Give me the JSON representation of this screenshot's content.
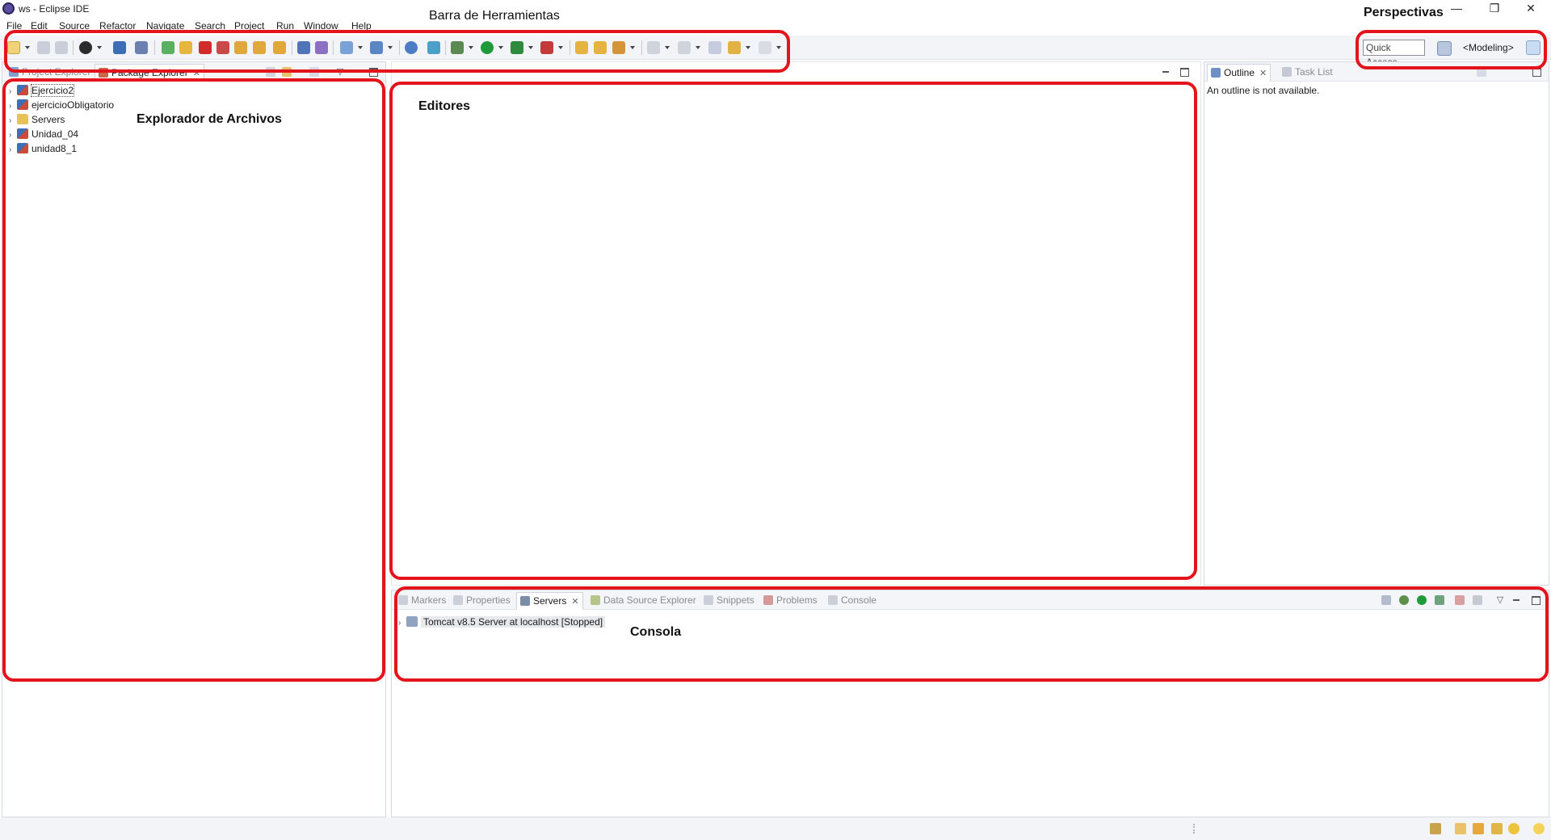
{
  "window": {
    "title": "ws - Eclipse IDE",
    "controls": {
      "minimize": "—",
      "restore": "❐",
      "close": "✕"
    }
  },
  "menu": [
    "File",
    "Edit",
    "Source",
    "Refactor",
    "Navigate",
    "Search",
    "Project",
    "Run",
    "Window",
    "Help"
  ],
  "toolbar": {
    "quick_access": "Quick Access",
    "perspective": "<Modeling>"
  },
  "explorer": {
    "tabs": [
      "Project Explorer",
      "Package Explorer"
    ],
    "active_tab_close": "✕",
    "items": [
      "Ejercicio2",
      "ejercicioObligatorio",
      "Servers",
      "Unidad_04",
      "unidad8_1"
    ]
  },
  "outline": {
    "tabs": [
      "Outline",
      "Task List"
    ],
    "message": "An outline is not available."
  },
  "bottom": {
    "tabs": [
      "Markers",
      "Properties",
      "Servers",
      "Data Source Explorer",
      "Snippets",
      "Problems",
      "Console"
    ],
    "server_item": "Tomcat v8.5 Server at localhost  [Stopped]"
  },
  "annotations": {
    "toolbar": "Barra de Herramientas",
    "perspectives": "Perspectivas",
    "explorer": "Explorador de Archivos",
    "editors": "Editores",
    "console": "Consola"
  },
  "colors": {
    "annotation": "#e3141b",
    "toolbar_bg": "#f2f4f8",
    "run_green": "#1f9a3b",
    "stop_red": "#d22b2b"
  }
}
